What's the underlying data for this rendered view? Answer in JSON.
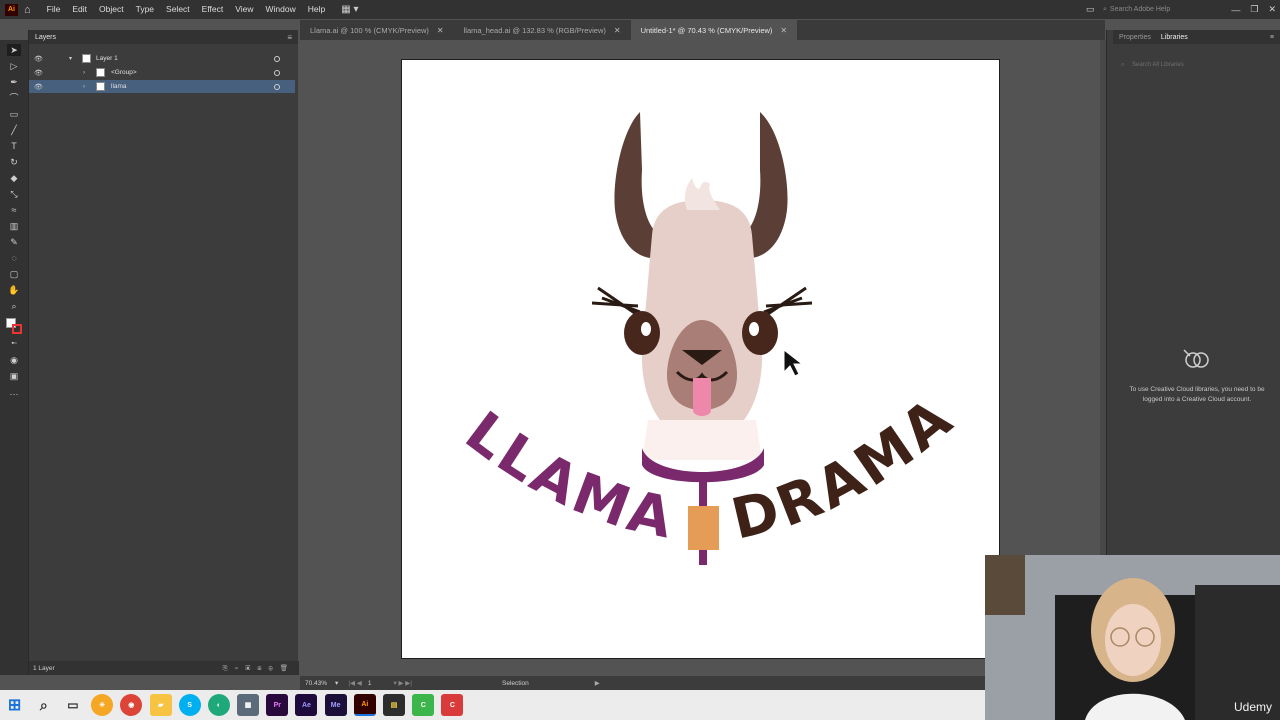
{
  "app": {
    "logo": "Ai"
  },
  "menu": {
    "items": [
      "File",
      "Edit",
      "Object",
      "Type",
      "Select",
      "Effect",
      "View",
      "Window",
      "Help"
    ]
  },
  "search": {
    "placeholder": "Search Adobe Help"
  },
  "tabs": [
    {
      "label": "Llama.ai @ 100 % (CMYK/Preview)",
      "active": false
    },
    {
      "label": "llama_head.ai @ 132.83 % (RGB/Preview)",
      "active": false
    },
    {
      "label": "Untitled-1* @ 70.43 % (CMYK/Preview)",
      "active": true
    }
  ],
  "layers_panel": {
    "tab": "Layers",
    "rows": [
      {
        "name": "Layer 1",
        "selected": false
      },
      {
        "name": "<Group>",
        "selected": false
      },
      {
        "name": "llama",
        "selected": true
      }
    ],
    "footer": "1 Layer"
  },
  "right_panel": {
    "tabs": [
      "Properties",
      "Libraries"
    ],
    "active_tab": "Libraries",
    "search_placeholder": "Search All Libraries",
    "message": "To use Creative Cloud libraries, you need to be logged into a Creative Cloud account."
  },
  "status": {
    "zoom": "70.43%",
    "artboard": "1",
    "tool": "Selection"
  },
  "artwork": {
    "word_left": "LLAMA",
    "word_right": "DRAMA"
  },
  "colors": {
    "accent": "#46607e",
    "word_left": "#7a2a6c",
    "word_right": "#3e2218",
    "horn": "#5b3e35",
    "face": "#e6cfc9",
    "muzzle": "#a87e76",
    "tongue": "#ee88aa",
    "bell": "#e59c56"
  },
  "watermark": "Udemy"
}
